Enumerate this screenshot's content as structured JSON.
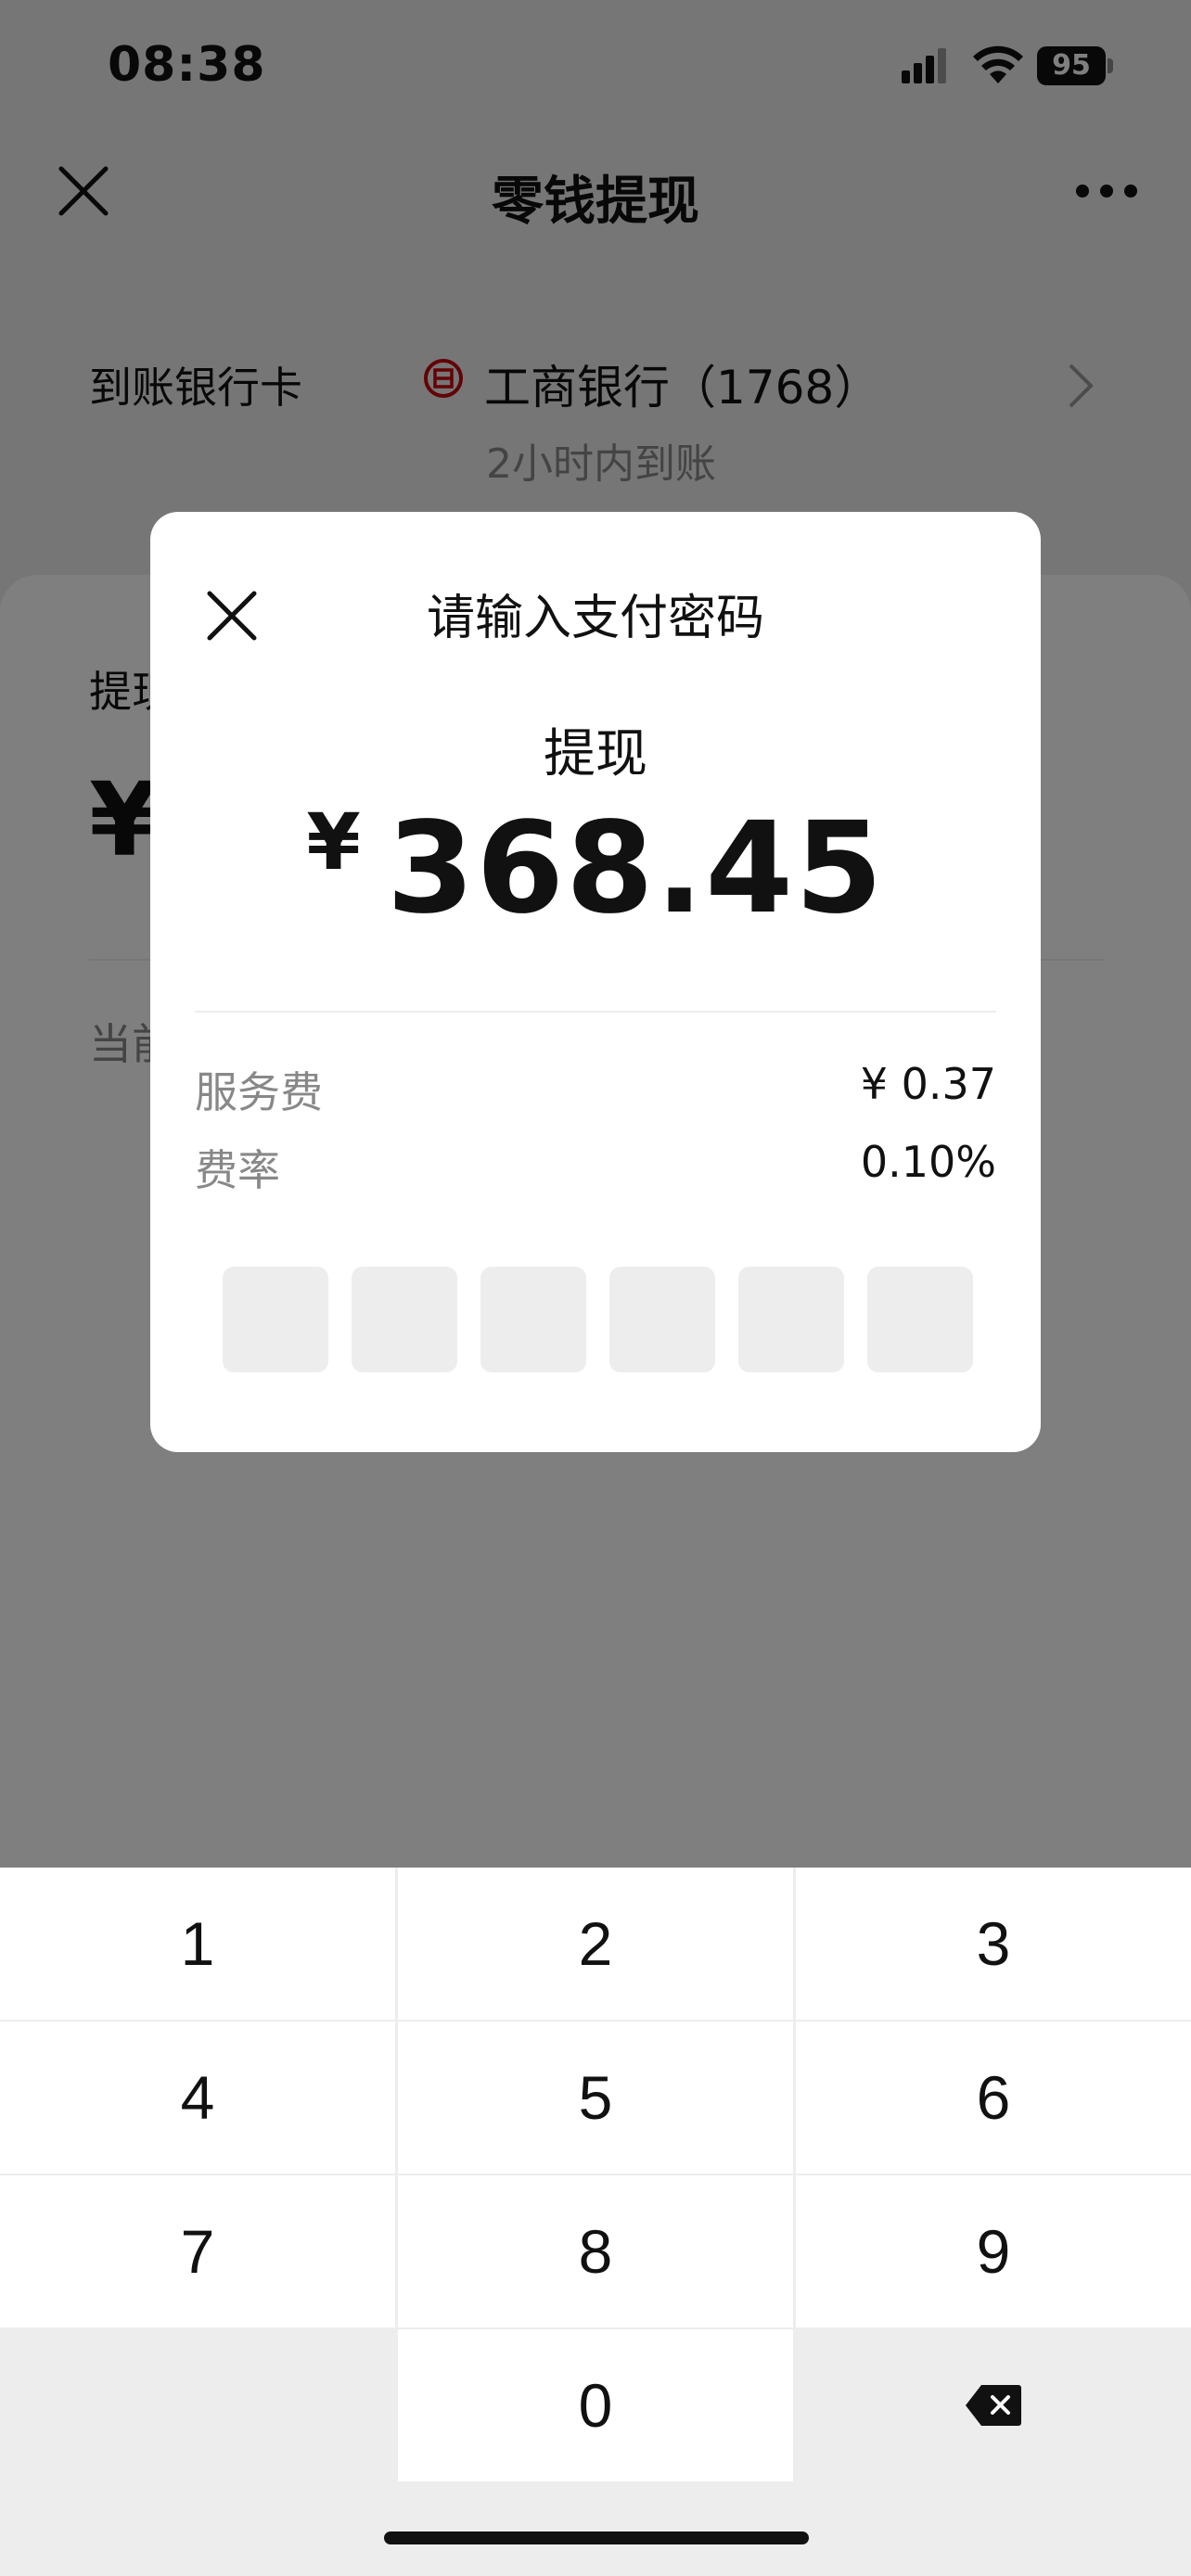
{
  "status_bar": {
    "time": "08:38",
    "battery": "95"
  },
  "nav": {
    "title": "零钱提现",
    "close_icon": "close-icon",
    "more_icon": "more-icon"
  },
  "bank": {
    "label": "到账银行卡",
    "name": "工商银行（1768）",
    "arrival": "2小时内到账",
    "logo_color": "#c7000b"
  },
  "card": {
    "label": "提现",
    "currency": "¥",
    "current": "当前"
  },
  "dialog": {
    "title": "请输入支付密码",
    "subtitle": "提现",
    "currency": "¥",
    "amount": "368.45",
    "fees": [
      {
        "label": "服务费",
        "value": "¥ 0.37"
      },
      {
        "label": "费率",
        "value": "0.10%"
      }
    ],
    "pin_length": 6
  },
  "keypad": {
    "keys": [
      "1",
      "2",
      "3",
      "4",
      "5",
      "6",
      "7",
      "8",
      "9",
      "0"
    ],
    "backspace_icon": "backspace-icon"
  }
}
